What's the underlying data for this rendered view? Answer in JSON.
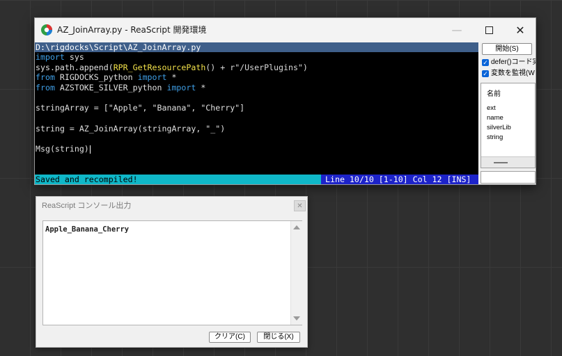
{
  "ide": {
    "title": "AZ_JoinArray.py - ReaScript 開発環境",
    "path": "D:\\rigdocks\\Script\\AZ_JoinArray.py",
    "status_left": "Saved and recompiled!",
    "status_right": "Line 10/10 [1-10] Col 12 [INS]",
    "colors": {
      "path_bar": "#3f5f8a",
      "status_bar": "#0fb7c8",
      "status_right": "#1d23c9",
      "keyword": "#3f9fe6",
      "function": "#f2e14a"
    }
  },
  "code": {
    "l1_kw": "import",
    "l1_rest": " sys",
    "l2_a": "sys.path.append(",
    "l2_fn": "RPR_GetResourcePath",
    "l2_b": "() + r\"/UserPlugins\")",
    "l3_kw1": "from",
    "l3_mid": " RIGDOCKS_python ",
    "l3_kw2": "import",
    "l3_end": " *",
    "l4_kw1": "from",
    "l4_mid": " AZSTOKE_SILVER_python ",
    "l4_kw2": "import",
    "l4_end": " *",
    "l6": "stringArray = [\"Apple\", \"Banana\", \"Cherry\"]",
    "l8": "string = AZ_JoinArray(stringArray, \"_\")",
    "l10": "Msg(string)"
  },
  "side": {
    "start_label": "開始(S)",
    "defer_label": "defer()コード実",
    "watch_label": "変数を監視(W",
    "vars_header": "名前",
    "vars": [
      "ext",
      "name",
      "silverLib",
      "string"
    ]
  },
  "console": {
    "title": "ReaScript コンソール出力",
    "close_glyph": "✕",
    "output": "Apple_Banana_Cherry",
    "clear_label": "クリア(C)",
    "close_label": "閉じる(X)"
  }
}
